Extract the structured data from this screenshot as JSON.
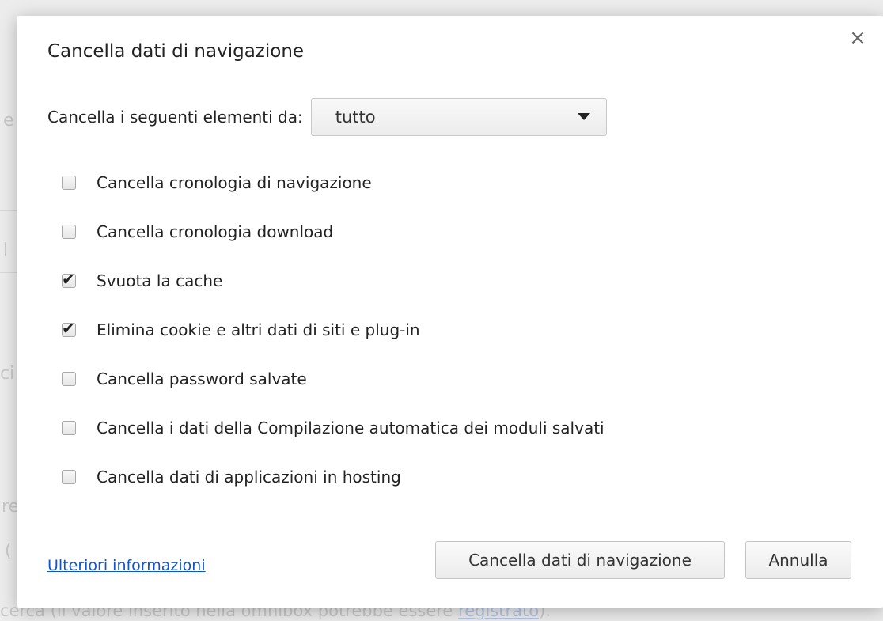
{
  "background": {
    "fragments": [
      "e",
      "l",
      "ci",
      "re",
      "(",
      "cerca (il valore inserito nella omnibox potrebbe essere "
    ],
    "link": "registrato",
    "tail": ")."
  },
  "dialog": {
    "title": "Cancella dati di navigazione",
    "close_label": "×",
    "period_label": "Cancella i seguenti elementi da:",
    "period_value": "tutto",
    "options": [
      {
        "label": "Cancella cronologia di navigazione",
        "checked": false
      },
      {
        "label": "Cancella cronologia download",
        "checked": false
      },
      {
        "label": "Svuota la cache",
        "checked": true
      },
      {
        "label": "Elimina cookie e altri dati di siti e plug-in",
        "checked": true
      },
      {
        "label": "Cancella password salvate",
        "checked": false
      },
      {
        "label": "Cancella i dati della Compilazione automatica dei moduli salvati",
        "checked": false
      },
      {
        "label": "Cancella dati di applicazioni in hosting",
        "checked": false
      }
    ],
    "check_glyph": "✔",
    "more_info_link": "Ulteriori informazioni",
    "clear_button": "Cancella dati di navigazione",
    "cancel_button": "Annulla"
  }
}
